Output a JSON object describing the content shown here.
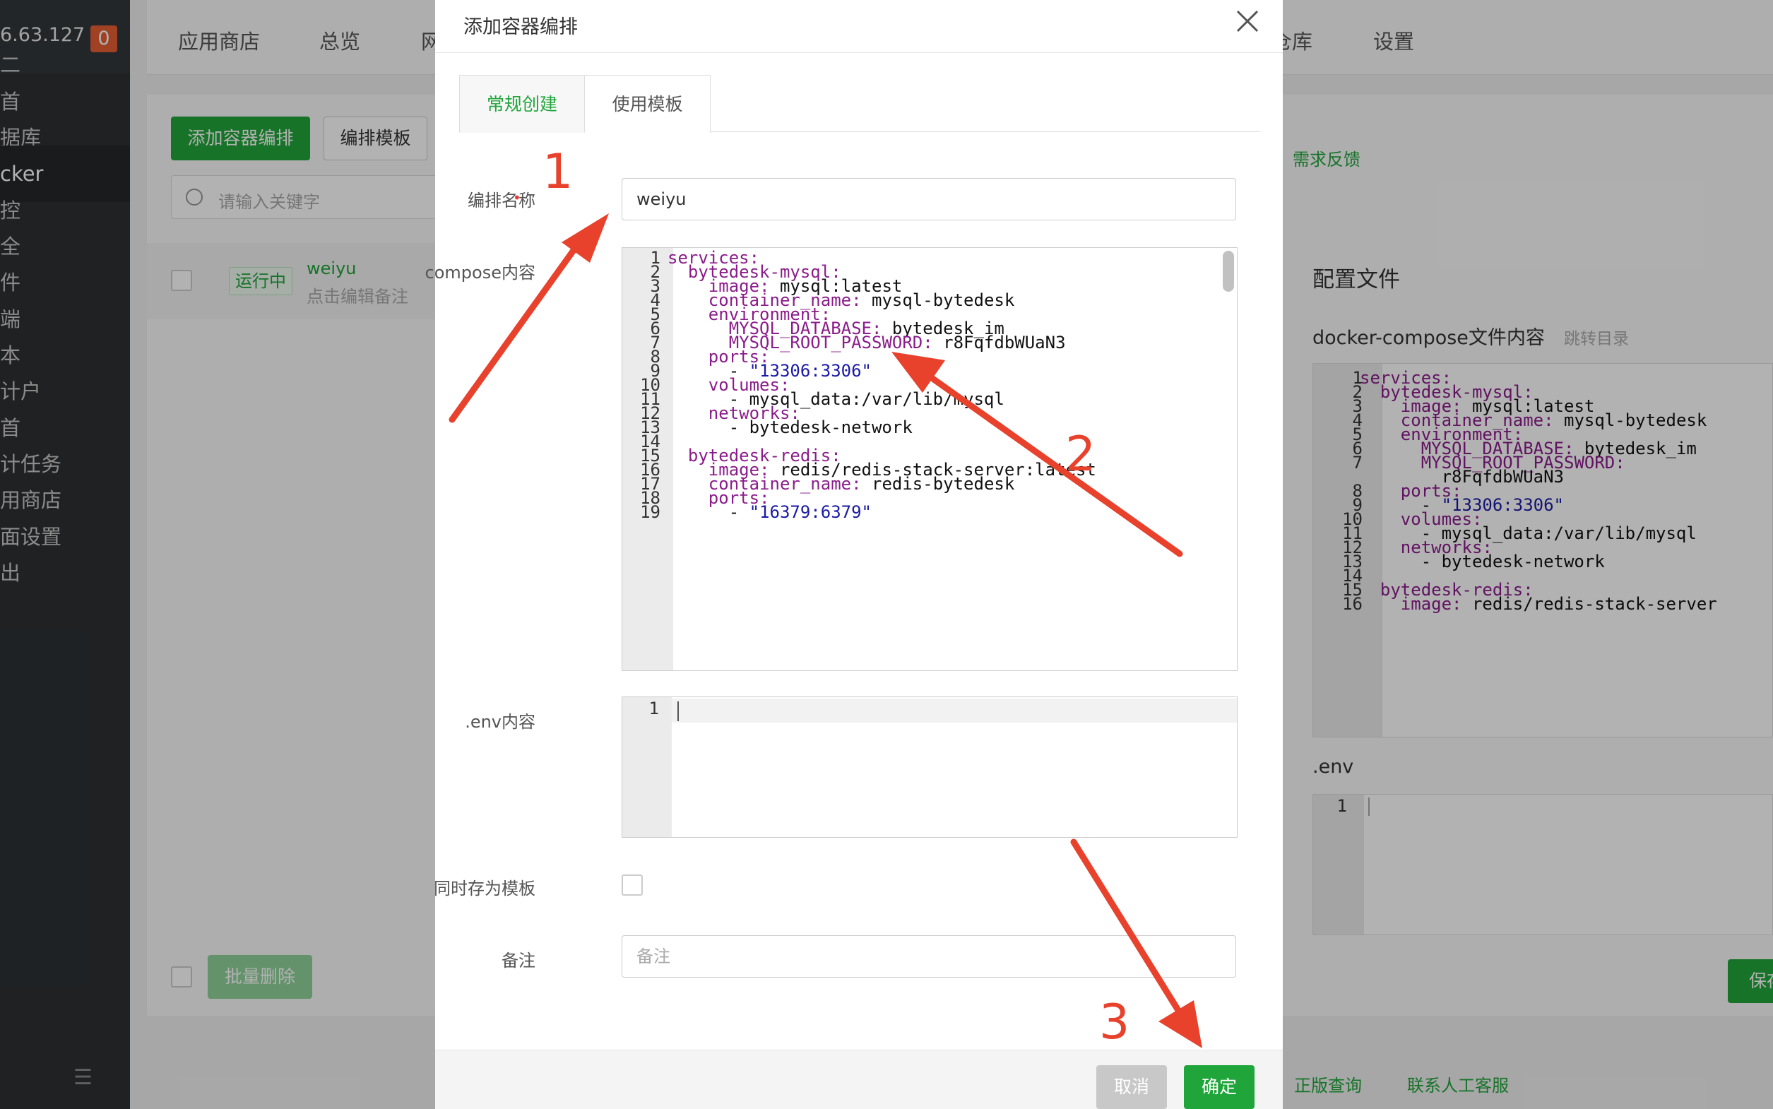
{
  "sidebar": {
    "ip": "6.63.127",
    "badge": "0",
    "items": [
      "二",
      "首",
      "据库",
      "cker",
      "控",
      "全",
      "件",
      "端",
      "本",
      "计户",
      "首",
      "计任务",
      "用商店",
      "面设置",
      "出"
    ]
  },
  "topnav": {
    "items": [
      "应用商店",
      "总览",
      "网",
      "仓库",
      "设置"
    ]
  },
  "bg_left": {
    "add_button": "添加容器编排",
    "template_button": "编排模板",
    "search_placeholder": "请输入关键字",
    "row": {
      "status": "运行中",
      "name": "weiyu",
      "note": "点击编辑备注"
    },
    "batch_delete": "批量删除"
  },
  "bg_right": {
    "feedback": "需求反馈",
    "config_title": "配置文件",
    "compose_title": "docker-compose文件内容",
    "jump": "跳转目录",
    "env_title": ".env",
    "env_line": "1",
    "save": "保存",
    "link1": "正版查询",
    "link2": "联系人工客服",
    "lines": [
      {
        "n": "1",
        "parts": [
          {
            "t": "services:",
            "c": "k"
          }
        ]
      },
      {
        "n": "2",
        "parts": [
          {
            "t": "  "
          },
          {
            "t": "bytedesk-mysql:",
            "c": "k"
          }
        ]
      },
      {
        "n": "3",
        "parts": [
          {
            "t": "    "
          },
          {
            "t": "image:",
            "c": "k"
          },
          {
            "t": " mysql:latest"
          }
        ]
      },
      {
        "n": "4",
        "parts": [
          {
            "t": "    "
          },
          {
            "t": "container_name:",
            "c": "k"
          },
          {
            "t": " mysql-bytedesk"
          }
        ]
      },
      {
        "n": "5",
        "parts": [
          {
            "t": "    "
          },
          {
            "t": "environment:",
            "c": "k"
          }
        ]
      },
      {
        "n": "6",
        "parts": [
          {
            "t": "      "
          },
          {
            "t": "MYSQL_DATABASE:",
            "c": "k"
          },
          {
            "t": " bytedesk_im"
          }
        ]
      },
      {
        "n": "7",
        "parts": [
          {
            "t": "      "
          },
          {
            "t": "MYSQL_ROOT_PASSWORD:",
            "c": "k"
          }
        ]
      },
      {
        "n": "",
        "parts": [
          {
            "t": "        r8FqfdbWUaN3"
          }
        ]
      },
      {
        "n": "8",
        "parts": [
          {
            "t": "    "
          },
          {
            "t": "ports:",
            "c": "k"
          }
        ]
      },
      {
        "n": "9",
        "parts": [
          {
            "t": "      - "
          },
          {
            "t": "\"13306:3306\"",
            "c": "s"
          }
        ]
      },
      {
        "n": "10",
        "parts": [
          {
            "t": "    "
          },
          {
            "t": "volumes:",
            "c": "k"
          }
        ]
      },
      {
        "n": "11",
        "parts": [
          {
            "t": "      - mysql_data:/var/lib/mysql"
          }
        ]
      },
      {
        "n": "12",
        "parts": [
          {
            "t": "    "
          },
          {
            "t": "networks:",
            "c": "k"
          }
        ]
      },
      {
        "n": "13",
        "parts": [
          {
            "t": "      - bytedesk-network"
          }
        ]
      },
      {
        "n": "14",
        "parts": [
          {
            "t": ""
          }
        ]
      },
      {
        "n": "15",
        "parts": [
          {
            "t": "  "
          },
          {
            "t": "bytedesk-redis:",
            "c": "k"
          }
        ]
      },
      {
        "n": "16",
        "parts": [
          {
            "t": "    "
          },
          {
            "t": "image:",
            "c": "k"
          },
          {
            "t": " redis/redis-stack-server"
          }
        ]
      }
    ]
  },
  "modal": {
    "title": "添加容器编排",
    "tabs": [
      "常规创建",
      "使用模板"
    ],
    "name_label": "编排名称",
    "name_value": "weiyu",
    "compose_label": "compose内容",
    "env_label": ".env内容",
    "env_line": "1",
    "save_template_label": "同时存为模板",
    "remark_label": "备注",
    "remark_placeholder": "备注",
    "cancel": "取消",
    "ok": "确定",
    "compose_lines": [
      {
        "n": "1",
        "parts": [
          {
            "t": "services:",
            "c": "k"
          }
        ]
      },
      {
        "n": "2",
        "parts": [
          {
            "t": "  "
          },
          {
            "t": "bytedesk-mysql:",
            "c": "k"
          }
        ]
      },
      {
        "n": "3",
        "parts": [
          {
            "t": "    "
          },
          {
            "t": "image:",
            "c": "k"
          },
          {
            "t": " mysql:latest"
          }
        ]
      },
      {
        "n": "4",
        "parts": [
          {
            "t": "    "
          },
          {
            "t": "container_name:",
            "c": "k"
          },
          {
            "t": " mysql-bytedesk"
          }
        ]
      },
      {
        "n": "5",
        "parts": [
          {
            "t": "    "
          },
          {
            "t": "environment:",
            "c": "k"
          }
        ]
      },
      {
        "n": "6",
        "parts": [
          {
            "t": "      "
          },
          {
            "t": "MYSQL_DATABASE:",
            "c": "k"
          },
          {
            "t": " bytedesk_im"
          }
        ]
      },
      {
        "n": "7",
        "parts": [
          {
            "t": "      "
          },
          {
            "t": "MYSQL_ROOT_PASSWORD:",
            "c": "k"
          },
          {
            "t": " r8FqfdbWUaN3"
          }
        ]
      },
      {
        "n": "8",
        "parts": [
          {
            "t": "    "
          },
          {
            "t": "ports:",
            "c": "k"
          }
        ]
      },
      {
        "n": "9",
        "parts": [
          {
            "t": "      - "
          },
          {
            "t": "\"13306:3306\"",
            "c": "s"
          }
        ]
      },
      {
        "n": "10",
        "parts": [
          {
            "t": "    "
          },
          {
            "t": "volumes:",
            "c": "k"
          }
        ]
      },
      {
        "n": "11",
        "parts": [
          {
            "t": "      - mysql_data:/var/lib/mysql"
          }
        ]
      },
      {
        "n": "12",
        "parts": [
          {
            "t": "    "
          },
          {
            "t": "networks:",
            "c": "k"
          }
        ]
      },
      {
        "n": "13",
        "parts": [
          {
            "t": "      - bytedesk-network"
          }
        ]
      },
      {
        "n": "14",
        "parts": [
          {
            "t": ""
          }
        ]
      },
      {
        "n": "15",
        "parts": [
          {
            "t": "  "
          },
          {
            "t": "bytedesk-redis:",
            "c": "k"
          }
        ]
      },
      {
        "n": "16",
        "parts": [
          {
            "t": "    "
          },
          {
            "t": "image:",
            "c": "k"
          },
          {
            "t": " redis/redis-stack-server:latest"
          }
        ]
      },
      {
        "n": "17",
        "parts": [
          {
            "t": "    "
          },
          {
            "t": "container_name:",
            "c": "k"
          },
          {
            "t": " redis-bytedesk"
          }
        ]
      },
      {
        "n": "18",
        "parts": [
          {
            "t": "    "
          },
          {
            "t": "ports:",
            "c": "k"
          }
        ]
      },
      {
        "n": "19",
        "parts": [
          {
            "t": "      - "
          },
          {
            "t": "\"16379:6379\"",
            "c": "s"
          }
        ]
      }
    ]
  },
  "annotations": {
    "color": "#e8412c",
    "labels": [
      "1",
      "2",
      "3"
    ]
  }
}
